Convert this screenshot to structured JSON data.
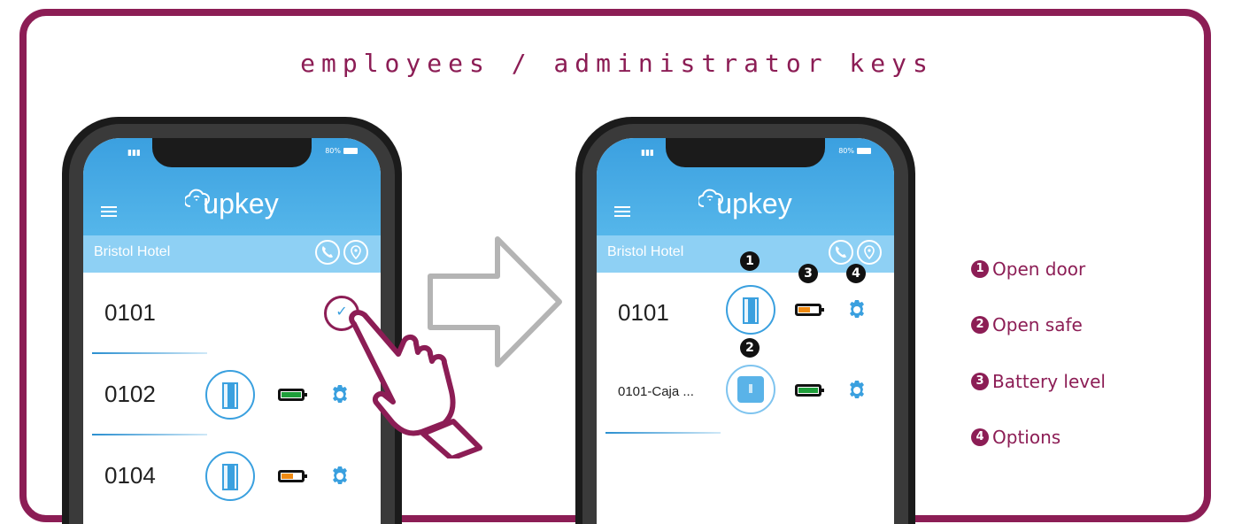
{
  "header": {
    "title": "employees / administrator keys"
  },
  "app": {
    "logo": "upkey",
    "hotel": "Bristol Hotel",
    "status": {
      "battery": "80%"
    }
  },
  "phone_left": {
    "rooms": [
      {
        "label": "0101",
        "state": "selected"
      },
      {
        "label": "0102",
        "battery": "full"
      },
      {
        "label": "0104",
        "battery": "medium"
      }
    ]
  },
  "phone_right": {
    "rooms": [
      {
        "label": "0101",
        "battery": "medium"
      },
      {
        "label": "0101-Caja ...",
        "battery": "full"
      }
    ],
    "markers": [
      "1",
      "2",
      "3",
      "4"
    ]
  },
  "legend": {
    "items": [
      {
        "num": "1",
        "label": "Open door"
      },
      {
        "num": "2",
        "label": "Open safe"
      },
      {
        "num": "3",
        "label": "Battery level"
      },
      {
        "num": "4",
        "label": "Options"
      }
    ]
  },
  "colors": {
    "brand": "#8c1d55",
    "app_blue": "#3ba0e0",
    "app_light": "#8ed0f4",
    "battery_full": "#1e9e3a",
    "battery_medium": "#f08a12"
  }
}
